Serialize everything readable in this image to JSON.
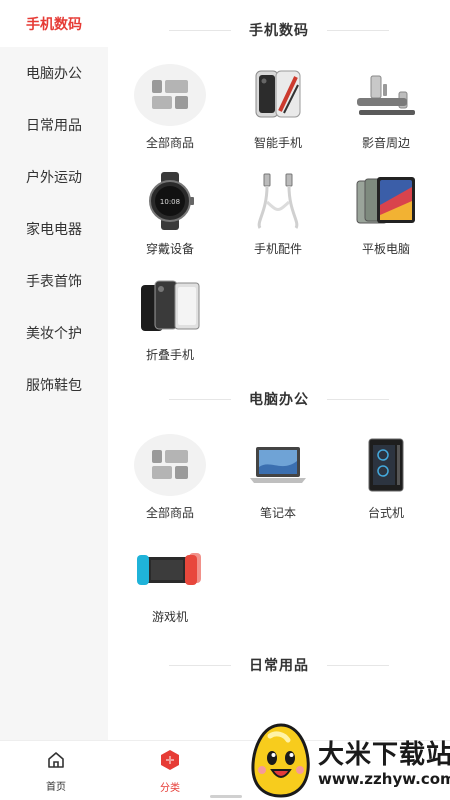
{
  "sidebar": {
    "items": [
      {
        "label": "手机数码",
        "active": true
      },
      {
        "label": "电脑办公",
        "active": false
      },
      {
        "label": "日常用品",
        "active": false
      },
      {
        "label": "户外运动",
        "active": false
      },
      {
        "label": "家电电器",
        "active": false
      },
      {
        "label": "手表首饰",
        "active": false
      },
      {
        "label": "美妆个护",
        "active": false
      },
      {
        "label": "服饰鞋包",
        "active": false
      }
    ]
  },
  "sections": [
    {
      "title": "手机数码",
      "items": [
        {
          "label": "全部商品",
          "icon": "all-products-icon"
        },
        {
          "label": "智能手机",
          "icon": "smartphone-icon"
        },
        {
          "label": "影音周边",
          "icon": "speaker-icon"
        },
        {
          "label": "穿戴设备",
          "icon": "smartwatch-icon"
        },
        {
          "label": "手机配件",
          "icon": "usb-cable-icon"
        },
        {
          "label": "平板电脑",
          "icon": "tablet-icon"
        },
        {
          "label": "折叠手机",
          "icon": "foldable-phone-icon"
        }
      ]
    },
    {
      "title": "电脑办公",
      "items": [
        {
          "label": "全部商品",
          "icon": "all-products-icon"
        },
        {
          "label": "笔记本",
          "icon": "laptop-icon"
        },
        {
          "label": "台式机",
          "icon": "desktop-pc-icon"
        },
        {
          "label": "游戏机",
          "icon": "game-console-icon"
        }
      ]
    },
    {
      "title": "日常用品",
      "items": []
    }
  ],
  "tabbar": {
    "tabs": [
      {
        "label": "首页",
        "icon": "home-icon",
        "active": false
      },
      {
        "label": "分类",
        "icon": "category-icon",
        "active": true
      }
    ]
  },
  "watermark": {
    "brand": "大米下载站",
    "url": "www.zzhyw.com"
  },
  "colors": {
    "accent": "#e63b35",
    "sidebar_bg": "#f6f6f6"
  }
}
